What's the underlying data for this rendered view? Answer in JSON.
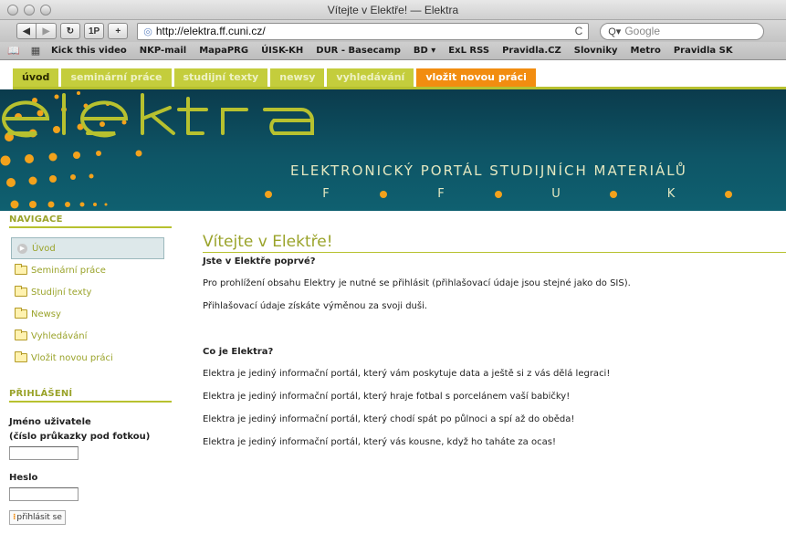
{
  "window": {
    "title": "Vítejte v Elektře! — Elektra"
  },
  "toolbar": {
    "back_icon": "back-arrow",
    "forward_icon": "forward-arrow",
    "reload_label": "↻",
    "onep_label": "1P",
    "add_label": "+",
    "url": "http://elektra.ff.cuni.cz/",
    "reload_icon": "C",
    "search_placeholder": "Google"
  },
  "bookmarks": [
    "Kick this video",
    "NKP-mail",
    "MapaPRG",
    "ÚISK-KH",
    "DUR - Basecamp",
    "BD ▾",
    "ExL RSS",
    "Pravidla.CZ",
    "Slovniky",
    "Metro",
    "Pravidla SK"
  ],
  "sitenav": {
    "tabs": [
      {
        "label": "úvod",
        "active": true
      },
      {
        "label": "seminární práce"
      },
      {
        "label": "studijní texty"
      },
      {
        "label": "newsy"
      },
      {
        "label": "vyhledávání"
      },
      {
        "label": "vložit novou práci",
        "orange": true
      }
    ]
  },
  "banner": {
    "logo": "elektra",
    "subtitle": "ELEKTRONICKÝ PORTÁL STUDIJNÍCH MATERIÁLŮ",
    "letters": [
      "F",
      "F",
      "U",
      "K"
    ]
  },
  "sidebar": {
    "nav_heading": "NAVIGACE",
    "items": [
      {
        "label": "Úvod",
        "active": true
      },
      {
        "label": "Seminární práce"
      },
      {
        "label": "Studijní texty"
      },
      {
        "label": "Newsy"
      },
      {
        "label": "Vyhledávání"
      },
      {
        "label": "Vložit novou práci"
      }
    ],
    "login_heading": "PŘIHLÁŠENÍ",
    "username_label_1": "Jméno uživatele",
    "username_label_2": "(číslo průkazky pod fotkou)",
    "password_label": "Heslo",
    "login_button": "přihlásit se"
  },
  "main": {
    "title": "Vítejte v Elektře!",
    "q1": "Jste v Elektře poprvé?",
    "p1": "Pro prohlížení obsahu Elektry je nutné se přihlásit (přihlašovací údaje jsou stejné jako do SIS).",
    "p2": "Přihlašovací údaje získáte výměnou za svoji duši.",
    "q2": "Co je Elektra?",
    "p3": "Elektra je jediný informační portál, který vám poskytuje data a ještě si z vás dělá legraci!",
    "p4": "Elektra je jediný informační portál, který hraje fotbal s porcelánem vaší babičky!",
    "p5": "Elektra je jediný informační portál, který chodí spát po půlnoci a spí až do oběda!",
    "p6": "Elektra je jediný informační portál, který vás kousne, když ho taháte za ocas!"
  },
  "colors": {
    "accent_green": "#b7c12f",
    "accent_orange": "#f28d10",
    "banner_teal": "#0e5566"
  }
}
